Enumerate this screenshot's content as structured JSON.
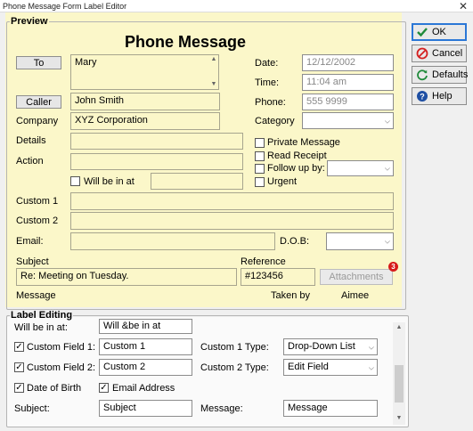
{
  "window": {
    "title": "Phone Message Form Label Editor",
    "close": "✕"
  },
  "preview": {
    "legend": "Preview",
    "heading": "Phone Message",
    "to_button": "To",
    "to_value": "Mary",
    "caller_button": "Caller",
    "caller_value": "John Smith",
    "company_label": "Company",
    "company_value": "XYZ Corporation",
    "details_label": "Details",
    "action_label": "Action",
    "will_be_in_label": "Will be in at",
    "date_label": "Date:",
    "date_value": "12/12/2002",
    "time_label": "Time:",
    "time_value": "11:04 am",
    "phone_label": "Phone:",
    "phone_value": "555 9999",
    "category_label": "Category",
    "private_label": "Private Message",
    "read_receipt_label": "Read Receipt",
    "follow_up_label": "Follow up by:",
    "urgent_label": "Urgent",
    "custom1_label": "Custom 1",
    "custom2_label": "Custom 2",
    "email_label": "Email:",
    "dob_label": "D.O.B:",
    "subject_label": "Subject",
    "subject_value": "Re: Meeting on Tuesday.",
    "reference_label": "Reference",
    "reference_value": "#123456",
    "attachments_button": "Attachments",
    "attachments_count": "3",
    "message_label": "Message",
    "taken_by_label": "Taken by",
    "taken_by_value": "Aimee"
  },
  "buttons": {
    "ok": "OK",
    "cancel": "Cancel",
    "defaults": "Defaults",
    "help": "Help"
  },
  "label_editing": {
    "legend": "Label Editing",
    "will_be_in_cut_label": "Will be in at:",
    "will_be_in_value": "Will &be in at",
    "custom_field1_label": "Custom Field 1:",
    "custom_field1_value": "Custom 1",
    "custom1_type_label": "Custom 1 Type:",
    "custom1_type_value": "Drop-Down List",
    "custom_field2_label": "Custom Field 2:",
    "custom_field2_value": "Custom 2",
    "custom2_type_label": "Custom 2 Type:",
    "custom2_type_value": "Edit Field",
    "dob_label": "Date of Birth",
    "email_label": "Email Address",
    "subject_label": "Subject:",
    "subject_value": "Subject",
    "message_label": "Message:",
    "message_value": "Message"
  },
  "state": {
    "custom_field1_checked": true,
    "custom_field2_checked": true,
    "dob_checked": true,
    "email_checked": true,
    "private_checked": false,
    "read_receipt_checked": false,
    "follow_up_checked": false,
    "urgent_checked": false,
    "will_be_in_checked": false
  },
  "icons": {
    "check_mark": "✓",
    "dropdown": "⌵",
    "scroll_up": "▲",
    "scroll_down": "▼"
  },
  "colors": {
    "preview_background": "#fbf7c9",
    "ok_border": "#2b77d6",
    "cancel_icon": "#d42020",
    "defaults_icon": "#1f8a3a",
    "help_icon": "#1e4fa3",
    "badge": "#d71a1a"
  }
}
